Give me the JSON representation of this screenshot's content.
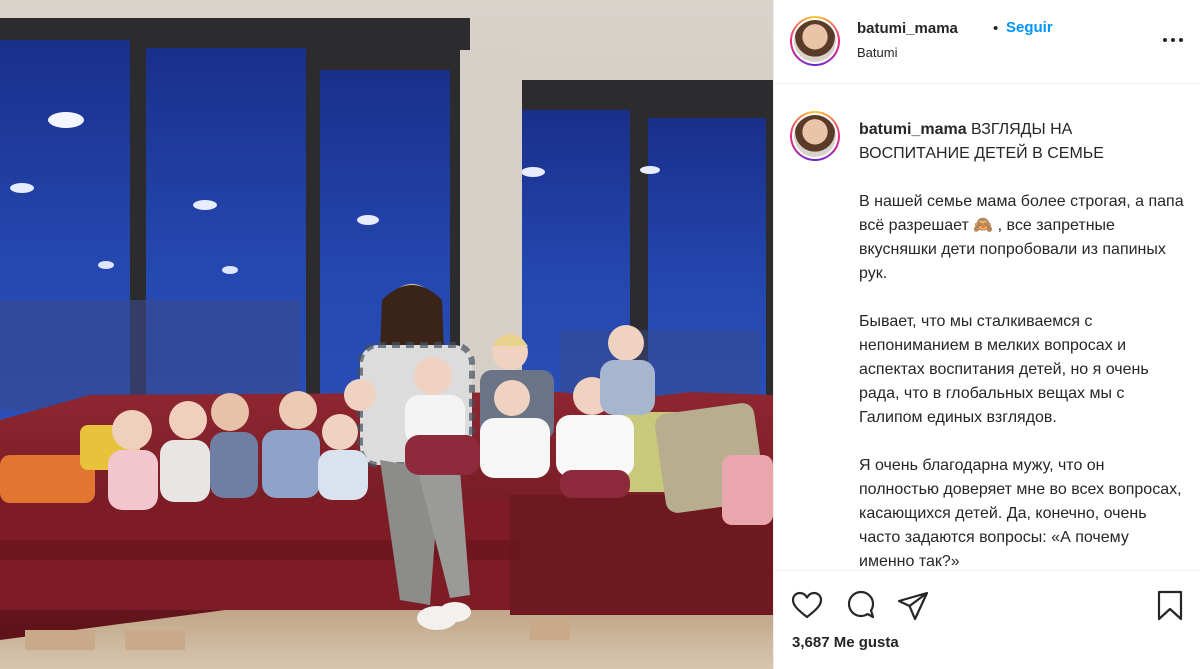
{
  "post": {
    "author": {
      "username": "batumi_mama",
      "location": "Batumi",
      "follow_label": "Seguir",
      "separator": "•"
    },
    "caption": {
      "username": "batumi_mama",
      "title": "ВЗГЛЯДЫ НА ВОСПИТАНИЕ ДЕТЕЙ В СЕМЬЕ",
      "paragraphs": [
        "В нашей семье мама более строгая, а папа всё разрешает 🙈 , все запретные вкусняшки дети попробовали из папиных рук.",
        "Бывает, что мы сталкиваемся с непониманием в мелких вопросах и аспектах воспитания детей, но я очень рада, что в глобальных вещах мы с Галипом единых взглядов.",
        "Я очень благодарна мужу, что он полностью доверяет мне во всех вопросах, касающихся детей. Да, конечно, очень часто задаются вопросы: «А почему именно так?»"
      ]
    },
    "likes": {
      "count": "3,687",
      "label": "Me gusta"
    },
    "icons": {
      "more": "more-options-icon",
      "like": "heart-icon",
      "comment": "comment-icon",
      "share": "paper-plane-icon",
      "save": "bookmark-icon"
    },
    "colors": {
      "accent_blue": "#0095f6",
      "text": "#262626",
      "border": "#efefef",
      "sofa_red": "#7a1a22",
      "window_blue": "#1d3d9a"
    }
  }
}
